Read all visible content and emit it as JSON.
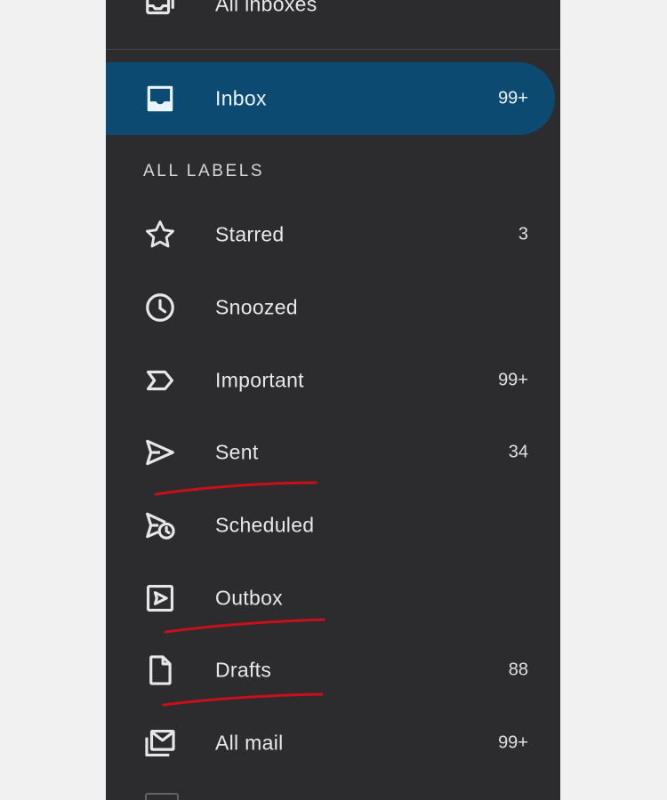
{
  "nav": {
    "top_partial": {
      "label": "All inboxes",
      "icon": "all-inboxes-icon"
    },
    "inbox": {
      "label": "Inbox",
      "count": "99+",
      "icon": "inbox-icon"
    },
    "section_title": "ALL LABELS",
    "labels": [
      {
        "label": "Starred",
        "count": "3",
        "icon": "star-icon"
      },
      {
        "label": "Snoozed",
        "count": "",
        "icon": "clock-icon"
      },
      {
        "label": "Important",
        "count": "99+",
        "icon": "important-icon"
      },
      {
        "label": "Sent",
        "count": "34",
        "icon": "send-icon"
      },
      {
        "label": "Scheduled",
        "count": "",
        "icon": "schedule-send-icon"
      },
      {
        "label": "Outbox",
        "count": "",
        "icon": "outbox-icon"
      },
      {
        "label": "Drafts",
        "count": "88",
        "icon": "draft-icon"
      },
      {
        "label": "All mail",
        "count": "99+",
        "icon": "all-mail-icon"
      }
    ]
  },
  "colors": {
    "drawer_bg": "#2c2c2e",
    "active_bg": "#0c4a72",
    "page_bg": "#f1f1f1",
    "annotation": "#c8101a"
  }
}
